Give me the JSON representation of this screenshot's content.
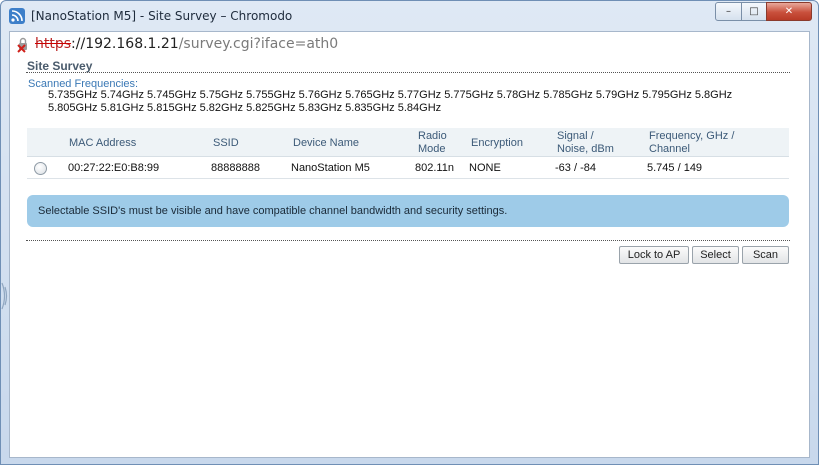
{
  "window": {
    "title": "[NanoStation M5] - Site Survey – Chromodo",
    "controls": {
      "minimize": "–",
      "maximize": "□",
      "close": "✕"
    }
  },
  "address": {
    "scheme": "https",
    "separator": "://",
    "host": "192.168.1.21",
    "path": "/survey.cgi?iface=ath0"
  },
  "page": {
    "title": "Site Survey",
    "scanned_label": "Scanned Frequencies:",
    "frequencies": "5.735GHz 5.74GHz 5.745GHz 5.75GHz 5.755GHz 5.76GHz 5.765GHz 5.77GHz 5.775GHz 5.78GHz 5.785GHz 5.79GHz 5.795GHz 5.8GHz 5.805GHz 5.81GHz 5.815GHz 5.82GHz 5.825GHz 5.83GHz 5.835GHz 5.84GHz"
  },
  "table": {
    "headers": {
      "mac": "MAC Address",
      "ssid": "SSID",
      "device": "Device Name",
      "radio_1": "Radio",
      "radio_2": "Mode",
      "encryption": "Encryption",
      "signal_1": "Signal /",
      "signal_2": "Noise, dBm",
      "freq_1": "Frequency, GHz /",
      "freq_2": "Channel"
    },
    "rows": [
      {
        "mac": "00:27:22:E0:B8:99",
        "ssid": "88888888",
        "device": "NanoStation M5",
        "radio_mode": "802.11n",
        "encryption": "NONE",
        "signal_noise": "-63 / -84",
        "freq_channel": "5.745 / 149"
      }
    ]
  },
  "info": "Selectable SSID's must be visible and have compatible channel bandwidth and security settings.",
  "buttons": {
    "lock": "Lock to AP",
    "select": "Select",
    "scan": "Scan"
  },
  "colors": {
    "info_bg": "#9ecbe8",
    "header_text": "#3c5a78",
    "link_blue": "#3a78b5"
  }
}
